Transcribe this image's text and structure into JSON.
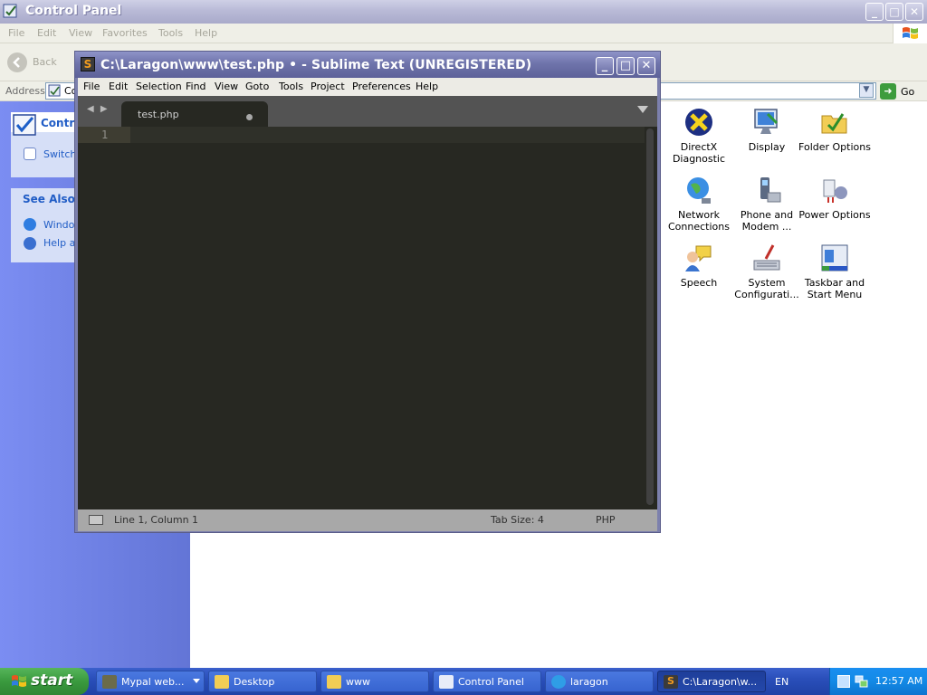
{
  "control_panel": {
    "title": "Control Panel",
    "menu": [
      "File",
      "Edit",
      "View",
      "Favorites",
      "Tools",
      "Help"
    ],
    "toolbar": {
      "back_label": "Back"
    },
    "address": {
      "label": "Address",
      "value": "Co",
      "go_label": "Go"
    },
    "left_pane": {
      "panel1": {
        "title": "Contro",
        "items": [
          "Switch"
        ]
      },
      "panel2": {
        "title": "See Also",
        "items": [
          "Window",
          "Help ar"
        ]
      }
    },
    "icons": [
      {
        "label": "DirectX Diagnostic",
        "icon": "directx-icon"
      },
      {
        "label": "Display",
        "icon": "display-icon"
      },
      {
        "label": "Folder Options",
        "icon": "folder-options-icon"
      },
      {
        "label": "Network Connections",
        "icon": "network-connections-icon"
      },
      {
        "label": "Phone and Modem ...",
        "icon": "phone-modem-icon"
      },
      {
        "label": "Power Options",
        "icon": "power-options-icon"
      },
      {
        "label": "Speech",
        "icon": "speech-icon"
      },
      {
        "label": "System Configurati...",
        "icon": "system-config-icon"
      },
      {
        "label": "Taskbar and Start Menu",
        "icon": "taskbar-start-icon"
      }
    ]
  },
  "sublime": {
    "title": "C:\\Laragon\\www\\test.php • - Sublime Text (UNREGISTERED)",
    "menu": [
      "File",
      "Edit",
      "Selection",
      "Find",
      "View",
      "Goto",
      "Tools",
      "Project",
      "Preferences",
      "Help"
    ],
    "tab": {
      "label": "test.php",
      "modified": true
    },
    "editor": {
      "line_numbers": [
        "1"
      ],
      "content": ""
    },
    "status": {
      "position": "Line 1, Column 1",
      "tab_size": "Tab Size: 4",
      "syntax": "PHP"
    }
  },
  "taskbar": {
    "start_label": "start",
    "buttons": [
      {
        "label": "Mypal web...",
        "icon": "mypal-icon"
      },
      {
        "label": "Desktop",
        "icon": "folder-icon"
      },
      {
        "label": "www",
        "icon": "folder-icon"
      },
      {
        "label": "Control Panel",
        "icon": "control-panel-icon"
      },
      {
        "label": "laragon",
        "icon": "laragon-icon"
      },
      {
        "label": "C:\\Laragon\\w...",
        "icon": "sublime-icon"
      }
    ],
    "language": "EN",
    "clock": "12:57 AM"
  },
  "colors": {
    "editor_bg": "#272822",
    "tabbar_bg": "#535353",
    "statusbar_bg": "#a8a8a8",
    "xp_blue": "#2a4fba",
    "start_green": "#3a9a3e"
  }
}
